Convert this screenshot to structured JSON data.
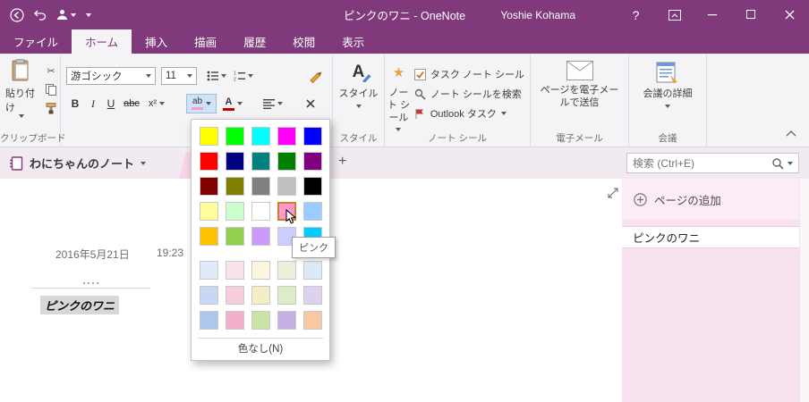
{
  "colors": {
    "accent_purple": "#80397B",
    "ribbon_bg": "#F4F3F5",
    "sidebar_pink": "#F9E2EF",
    "section_tab_pink": "#F7D4E7",
    "selection_gray": "#D8D8D8",
    "pressed_button_blue": "#CDE3F7",
    "selected_swatch_border": "#D07C28"
  },
  "titlebar": {
    "title": "ピンクのワニ - OneNote",
    "user": "Yoshie Kohama",
    "help": "?"
  },
  "ribbon_tabs": {
    "file": "ファイル",
    "items": [
      "ホーム",
      "挿入",
      "描画",
      "履歴",
      "校閲",
      "表示"
    ],
    "active": "ホーム"
  },
  "ribbon": {
    "paste": "貼り付け",
    "group_clipboard": "クリップボード",
    "font_name": "游ゴシック",
    "font_size": "11",
    "bold": "B",
    "italic": "I",
    "underline": "U",
    "strike": "abc",
    "superscript": "x²",
    "styles": "スタイル",
    "group_styles": "スタイル",
    "note_tags_button": "ノート シール",
    "task_tag": "タスク ノート シール",
    "find_tags": "ノート シールを検索",
    "outlook_tasks": "Outlook タスク",
    "group_tags": "ノート シール",
    "email_page": "ページを電子メールで送信",
    "group_email": "電子メール",
    "meeting_details": "会議の詳細",
    "group_meeting": "会議"
  },
  "icons": {
    "styles_letter": "A",
    "font_color_letter": "A",
    "highlight_letters": "ab"
  },
  "notebook_bar": {
    "notebook_name": "わにちゃんのノート",
    "add_section": "+",
    "search_placeholder": "検索 (Ctrl+E)"
  },
  "page": {
    "date": "2016年5月21日",
    "time": "19:23",
    "note_text": "ピンクのワニ"
  },
  "sidebar": {
    "add_page": "ページの追加",
    "pages": [
      "ピンクのワニ"
    ]
  },
  "dropdown": {
    "rows_main": [
      [
        "#FFFF00",
        "#00FF00",
        "#00FFFF",
        "#FF00FF",
        "#0000FF"
      ],
      [
        "#FF0000",
        "#000080",
        "#008080",
        "#008000",
        "#800080"
      ],
      [
        "#800000",
        "#808000",
        "#808080",
        "#C0C0C0",
        "#000000"
      ],
      [
        "#FFFF99",
        "#CCFFCC",
        "#FFFFFF",
        "#FF99CC",
        "#99CCFF"
      ],
      [
        "#FFC000",
        "#92D050",
        "#CC99FF",
        "#CCCCFF",
        "#00CCFF"
      ]
    ],
    "rows_pastel": [
      [
        "#E1EAF8",
        "#FBE3EC",
        "#FCF6DE",
        "#EAF2DE",
        "#DCE9F7"
      ],
      [
        "#C9D8F2",
        "#F7CCDC",
        "#F5EEC4",
        "#DCEBC8",
        "#DCD2EE"
      ],
      [
        "#AFC6EC",
        "#F2AFCB",
        "#CBE3A6",
        "#C4AFE4",
        "#F7C9A2"
      ]
    ],
    "selected": {
      "row": 3,
      "col": 3,
      "name": "ピンク"
    },
    "tooltip": "ピンク",
    "no_color": "色なし(N)"
  }
}
